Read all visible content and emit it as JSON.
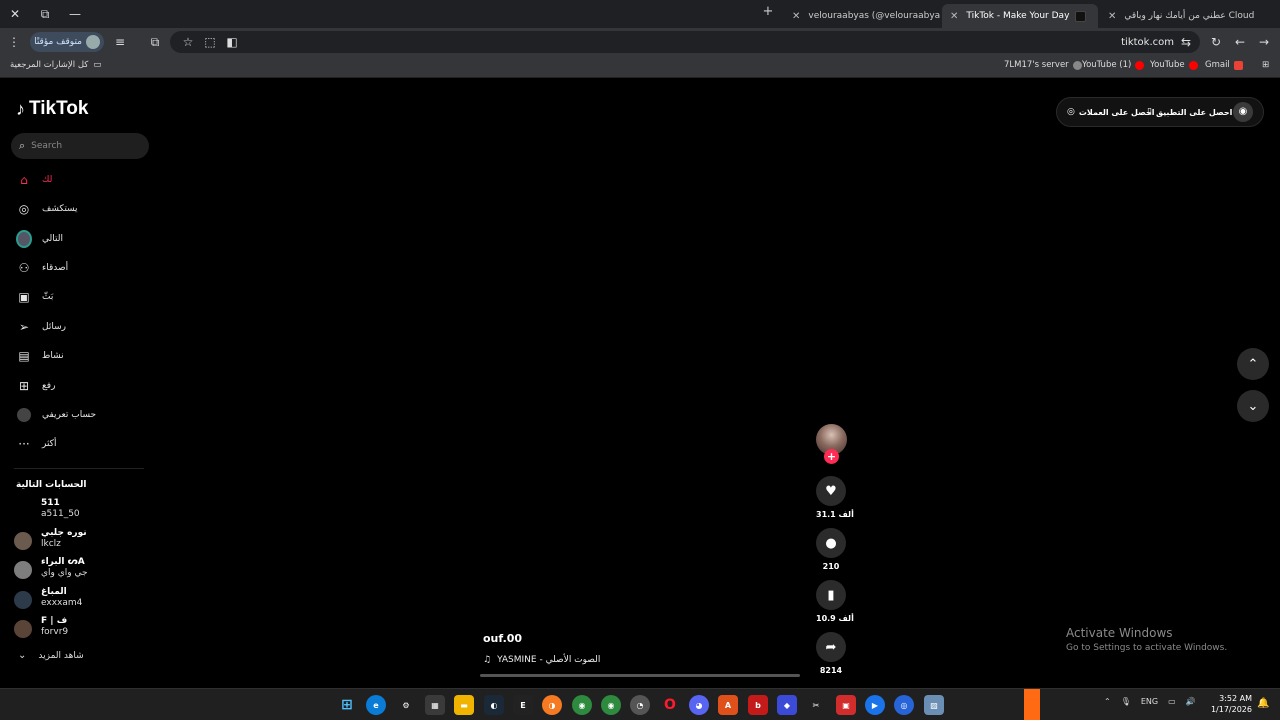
{
  "browser": {
    "tabs": [
      {
        "title": "عطني من أيامك نهار وباقي Cloud",
        "color": "#e35b2c"
      },
      {
        "title": "TikTok - Make Your Day",
        "color": "#000000"
      },
      {
        "title": "velouraabyas (@velouraabyas)",
        "color": "#000000"
      }
    ],
    "profile_label": "متوقف مؤقتًا",
    "url": "tiktok.com",
    "bookmarks": [
      {
        "label": "كل الإشارات المرجعية"
      },
      {
        "label": "7LM17's server"
      },
      {
        "label": "YouTube (1)"
      },
      {
        "label": "YouTube"
      },
      {
        "label": "Gmail"
      }
    ]
  },
  "sidebar": {
    "logo": "TikTok",
    "search_placeholder": "Search",
    "nav": [
      {
        "label": "لك",
        "icon": "home-icon"
      },
      {
        "label": "يستكشف",
        "icon": "compass-icon"
      },
      {
        "label": "التالي",
        "icon": "avatar-icon"
      },
      {
        "label": "أصدقاء",
        "icon": "friends-icon"
      },
      {
        "label": "بَثّ",
        "icon": "live-icon"
      },
      {
        "label": "رسائل",
        "icon": "messages-icon"
      },
      {
        "label": "نشاط",
        "icon": "activity-icon"
      },
      {
        "label": "رفع",
        "icon": "upload-icon"
      },
      {
        "label": "حساب تعريفي",
        "icon": "profile-icon"
      },
      {
        "label": "أكثر",
        "icon": "more-icon"
      }
    ],
    "following_heading": "الحسابات التالية",
    "accounts": [
      {
        "name": "511",
        "handle": "a511_50"
      },
      {
        "name": "نوره جلبي",
        "handle": "lkclz"
      },
      {
        "name": "البراء ᔕA",
        "handle": "جي واي واي"
      },
      {
        "name": "المباغ",
        "handle": "exxxam4"
      },
      {
        "name": "F | ف",
        "handle": "forvr9"
      }
    ],
    "see_more": "شاهد المزيد"
  },
  "top_right": {
    "coins_label": "احصل على العملات",
    "app_label": "احصل على التطبيق"
  },
  "video": {
    "caption": "ouf.00",
    "music": "YASMINE - الصوت الأصلي",
    "likes": "31.1 ألف",
    "comments": "210",
    "saves": "10.9 ألف",
    "shares": "8214"
  },
  "windows": {
    "activate_title": "Activate Windows",
    "activate_sub": "Go to Settings to activate Windows."
  },
  "taskbar": {
    "language": "ENG",
    "time": "3:52 AM",
    "date": "1/17/2026"
  }
}
